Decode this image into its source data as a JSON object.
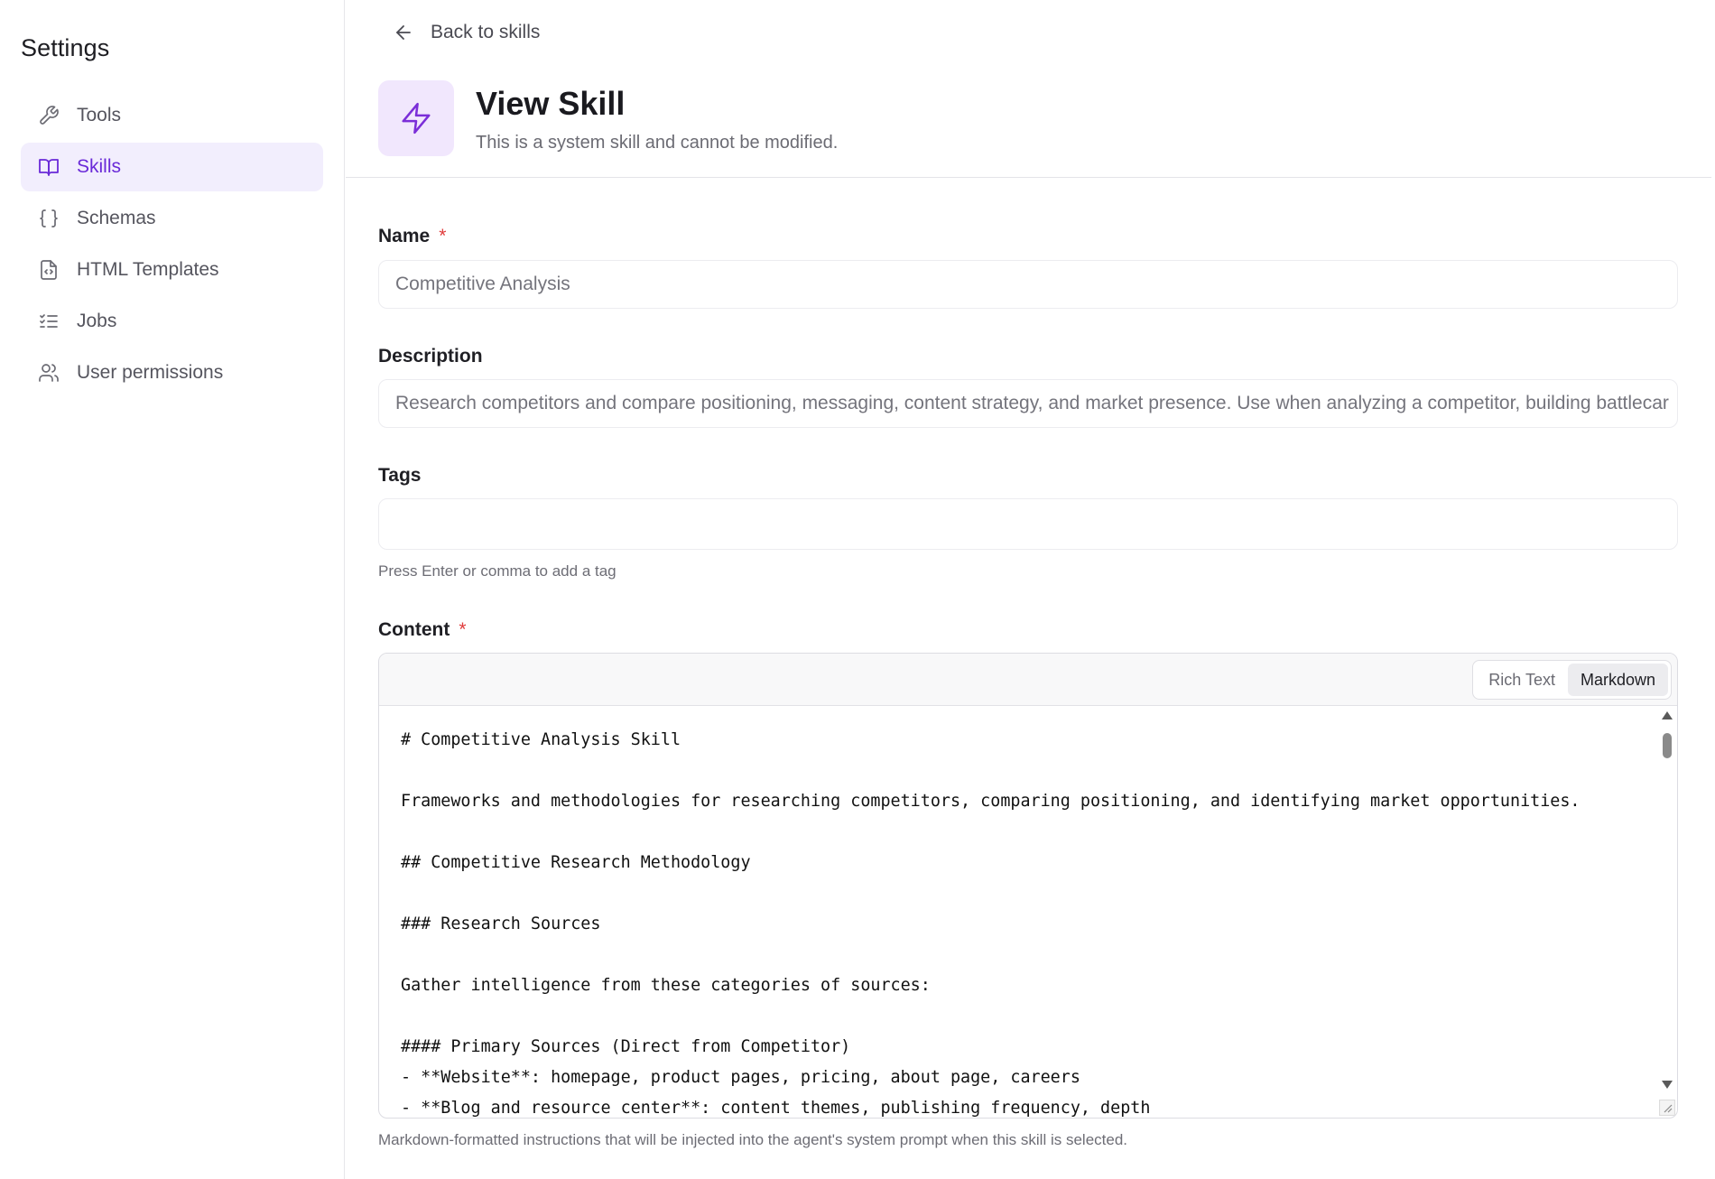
{
  "sidebar": {
    "title": "Settings",
    "items": [
      {
        "label": "Tools",
        "icon": "wrench-icon",
        "active": false
      },
      {
        "label": "Skills",
        "icon": "book-icon",
        "active": true
      },
      {
        "label": "Schemas",
        "icon": "braces-icon",
        "active": false
      },
      {
        "label": "HTML Templates",
        "icon": "file-code-icon",
        "active": false
      },
      {
        "label": "Jobs",
        "icon": "list-checks-icon",
        "active": false
      },
      {
        "label": "User permissions",
        "icon": "users-icon",
        "active": false
      }
    ]
  },
  "header": {
    "back_label": "Back to skills",
    "title": "View Skill",
    "subtitle": "This is a system skill and cannot be modified.",
    "icon": "lightning-icon"
  },
  "form": {
    "name": {
      "label": "Name",
      "required_mark": "*",
      "value": "Competitive Analysis"
    },
    "description": {
      "label": "Description",
      "value": "Research competitors and compare positioning, messaging, content strategy, and market presence. Use when analyzing a competitor, building battlecar"
    },
    "tags": {
      "label": "Tags",
      "value": "",
      "hint": "Press Enter or comma to add a tag"
    },
    "content": {
      "label": "Content",
      "required_mark": "*",
      "modes": [
        "Rich Text",
        "Markdown"
      ],
      "active_mode": "Markdown",
      "text": "# Competitive Analysis Skill\n\nFrameworks and methodologies for researching competitors, comparing positioning, and identifying market opportunities.\n\n## Competitive Research Methodology\n\n### Research Sources\n\nGather intelligence from these categories of sources:\n\n#### Primary Sources (Direct from Competitor)\n- **Website**: homepage, product pages, pricing, about page, careers\n- **Blog and resource center**: content themes, publishing frequency, depth",
      "hint": "Markdown-formatted instructions that will be injected into the agent's system prompt when this skill is selected."
    }
  },
  "colors": {
    "accent": "#6a2ad8",
    "active_bg": "#f2eefd",
    "icon_bg": "#f1e7fd",
    "required": "#e03c3c"
  }
}
